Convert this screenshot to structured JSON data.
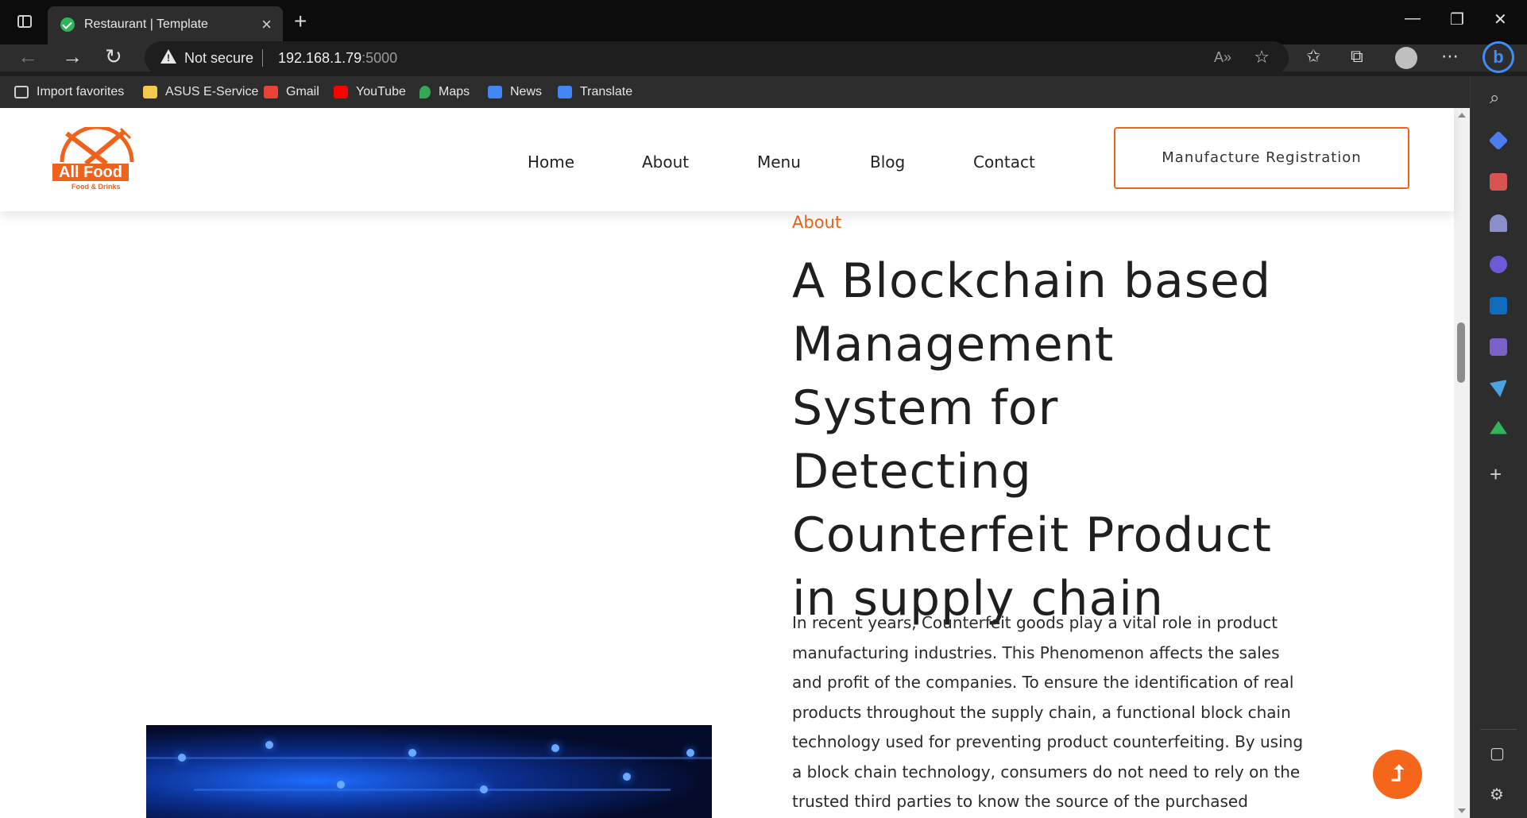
{
  "browser": {
    "tab_title": "Restaurant | Template",
    "security_label": "Not secure",
    "url_host": "192.168.1.79",
    "url_port": ":5000"
  },
  "bookmarks": [
    {
      "label": "Import favorites",
      "icon": "import-icon",
      "color": "#cfcfcf"
    },
    {
      "label": "ASUS E-Service",
      "icon": "folder-icon",
      "color": "#f2c94c"
    },
    {
      "label": "Gmail",
      "icon": "gmail-icon",
      "color": "#ea4335"
    },
    {
      "label": "YouTube",
      "icon": "youtube-icon",
      "color": "#ff0000"
    },
    {
      "label": "Maps",
      "icon": "maps-icon",
      "color": "#34a853"
    },
    {
      "label": "News",
      "icon": "news-icon",
      "color": "#4285f4"
    },
    {
      "label": "Translate",
      "icon": "translate-icon",
      "color": "#4285f4"
    }
  ],
  "site": {
    "logo_name": "All Food",
    "logo_tagline": "Food & Drinks",
    "nav": [
      "Home",
      "About",
      "Menu",
      "Blog",
      "Contact"
    ],
    "cta_label": "Manufacture Registration",
    "section_label": "About",
    "headline": "A Blockchain based Management System for Detecting Counterfeit Product in supply chain",
    "body": "In recent years, Counterfeit goods play a vital role in product manufacturing industries. This Phenomenon affects the sales and profit of the companies. To ensure the identification of real products throughout the supply chain, a functional block chain technology used for preventing product counterfeiting. By using a block chain technology, consumers do not need to rely on the trusted third parties to know the source of the purchased",
    "accent_color": "#f06119"
  }
}
